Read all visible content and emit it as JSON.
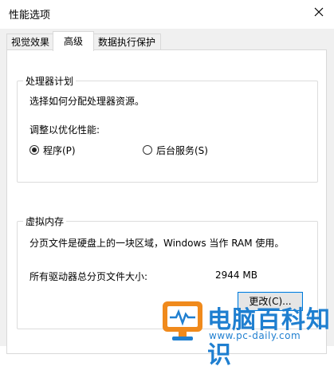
{
  "window": {
    "title": "性能选项"
  },
  "tabs": [
    {
      "label": "视觉效果",
      "active": false
    },
    {
      "label": "高级",
      "active": true
    },
    {
      "label": "数据执行保护",
      "active": false
    }
  ],
  "processor": {
    "group_title": "处理器计划",
    "description": "选择如何分配处理器资源。",
    "adjust_label": "调整以优化性能:",
    "options": [
      {
        "label": "程序(P)",
        "selected": true
      },
      {
        "label": "后台服务(S)",
        "selected": false
      }
    ]
  },
  "virtual_memory": {
    "group_title": "虚拟内存",
    "description": "分页文件是硬盘上的一块区域，Windows 当作 RAM 使用。",
    "total_label": "所有驱动器总分页文件大小:",
    "total_value": "2944 MB",
    "change_button": "更改(C)..."
  },
  "watermark": {
    "title": "电脑百科知识",
    "url": "www.pc-daily.com"
  },
  "colors": {
    "watermark_blue": "#1f7fd0",
    "watermark_orange": "#f08a1c",
    "button_border": "#0078d7"
  }
}
